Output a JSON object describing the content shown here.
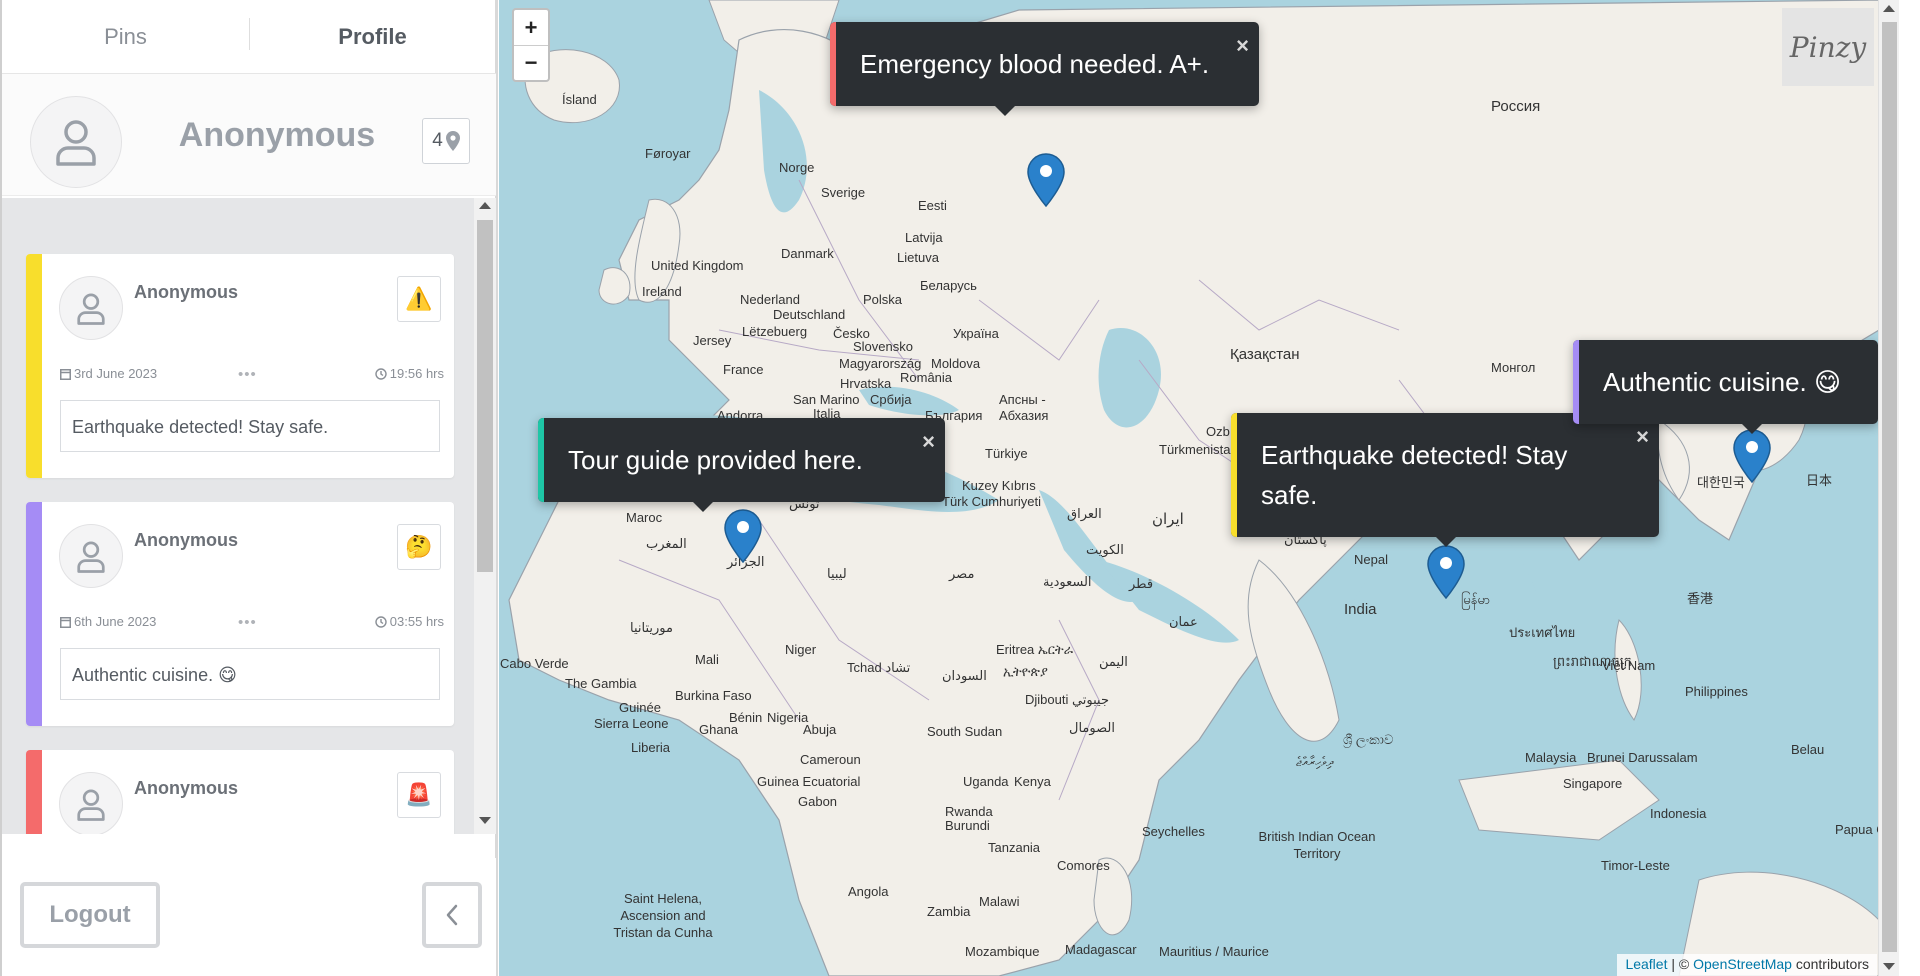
{
  "sidebar": {
    "tabs": [
      {
        "label": "Pins",
        "active": false
      },
      {
        "label": "Profile",
        "active": true
      }
    ],
    "profile": {
      "name": "Anonymous",
      "pin_count": "4",
      "avatar_icon": "user-icon",
      "pin_icon": "map-pin-icon"
    },
    "cards": [
      {
        "name": "Anonymous",
        "date": "3rd June 2023",
        "time": "19:56 hrs",
        "text": "Earthquake detected! Stay safe.",
        "icon": "⚠️",
        "icon_name": "warning-icon",
        "stripe_color": "#f8de2c"
      },
      {
        "name": "Anonymous",
        "date": "6th June 2023",
        "time": "03:55 hrs",
        "text": "Authentic cuisine. 😋",
        "icon": "🤔",
        "icon_name": "thinking-face-icon",
        "stripe_color": "#a58cf5"
      },
      {
        "name": "Anonymous",
        "date": "",
        "time": "",
        "text": "",
        "icon": "🚨",
        "icon_name": "siren-icon",
        "stripe_color": "#f46b6b"
      }
    ],
    "dots": "•••",
    "logout_label": "Logout",
    "collapse_icon": "chevron-left-icon"
  },
  "map": {
    "zoom_in": "+",
    "zoom_out": "−",
    "logo": "Pinzy",
    "popups": [
      {
        "text": "Emergency blood needed. A+.",
        "stripe_color": "#f46b6b"
      },
      {
        "text": "Tour guide provided here.",
        "stripe_color": "#1ec6a6"
      },
      {
        "text": "Earthquake detected! Stay safe.",
        "stripe_color": "#f8de2c"
      },
      {
        "text": "Authentic cuisine. 😋",
        "stripe_color": "#a58cf5"
      }
    ],
    "close_symbol": "×",
    "attribution": {
      "leaflet": "Leaflet",
      "sep": " | © ",
      "osm": "OpenStreetMap",
      "contributors": " contributors"
    },
    "labels": [
      "Ísland",
      "Føroyar",
      "Norge",
      "Sverige",
      "Eesti",
      "Latvija",
      "Lietuva",
      "Danmark",
      "United Kingdom",
      "Ireland",
      "Nederland",
      "Deutschland",
      "Polska",
      "Беларусь",
      "Україна",
      "Jersey",
      "Česko",
      "Slovensko",
      "Lëtzebuerg",
      "France",
      "Magyarország",
      "Moldova",
      "Hrvatska",
      "România",
      "San Marino",
      "Србија",
      "Andorra",
      "Italia",
      "България",
      "Россия",
      "Қазақстан",
      "Монгол",
      "Türkiye",
      "Türkmenistan",
      "Ozb",
      "Kuzey Kıbrıs",
      "Türk Cumhuriyeti",
      "ایران",
      "العراق",
      "الكويت",
      "السعودية",
      "قطر",
      "عمان",
      "اليمن",
      "مصر",
      "ليبيا",
      "تونس",
      "المغرب",
      "Maroc",
      "الجزائر",
      "موريتانيا",
      "Mali",
      "Niger",
      "Tchad تشاد",
      "السودان",
      "Eritrea ኤርትራ",
      "ኢትዮጵያ",
      "Djibouti جيبوتي",
      "الصومال",
      "Cabo Verde",
      "The Gambia",
      "Guinée",
      "Sierra Leone",
      "Liberia",
      "Burkina Faso",
      "Ghana",
      "Bénin",
      "Nigeria",
      "Cameroun",
      "Guinea Ecuatorial",
      "Gabon",
      "South Sudan",
      "Uganda",
      "Kenya",
      "Rwanda",
      "Burundi",
      "Tanzania",
      "Angola",
      "Zambia",
      "Malawi",
      "Mozambique",
      "Madagascar",
      "Comores",
      "Mauritius / Maurice",
      "Seychelles",
      "Saint Helena, Ascension and Tristan da Cunha",
      "British Indian Ocean Territory",
      "India",
      "Nepal",
      "پاکستان",
      "ශ්‍රී ලංකාව",
      "ދިވެހިރާއްޖެ",
      "မြန်မာ",
      "ประเทศไทย",
      "Việt Nam",
      "ព្រះរាជាណាចក្រ",
      "Philippines",
      "Malaysia",
      "Brunei Darussalam",
      "Singapore",
      "Indonesia",
      "Timor-Leste",
      "Belau",
      "Papua Guin",
      "日本",
      "대한민국",
      "香港",
      "Abuja",
      "Апсны - Абхазия"
    ]
  }
}
